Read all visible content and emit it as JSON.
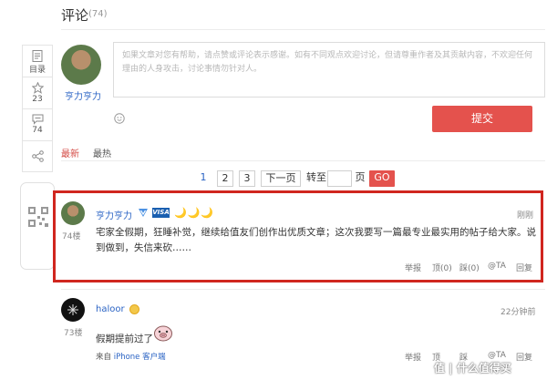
{
  "header": {
    "title": "评论",
    "count": "(74)"
  },
  "sidebar": {
    "items": [
      {
        "icon": "document-icon",
        "label": "目录"
      },
      {
        "icon": "star-icon",
        "label": "23"
      },
      {
        "icon": "comment-icon",
        "label": "74"
      },
      {
        "icon": "share-icon",
        "label": ""
      }
    ]
  },
  "composer": {
    "user_name": "亨力亨力",
    "placeholder": "如果文章对您有帮助，请点赞或评论表示感谢。如有不同观点欢迎讨论，但请尊重作者及其贡献内容，不欢迎任何理由的人身攻击，讨论事情勿针对人。",
    "submit_label": "提交"
  },
  "tabs": [
    {
      "label": "最新",
      "active": true
    },
    {
      "label": "最热",
      "active": false
    }
  ],
  "pagination": {
    "pages": [
      "1",
      "2",
      "3"
    ],
    "current": "1",
    "next_label": "下一页",
    "goto_label": "转至",
    "page_label": "页",
    "go_label": "GO"
  },
  "comments": [
    {
      "user": "亨力亨力",
      "badge": "VISA",
      "level_icons": "🌙🌙🌙",
      "floor": "74楼",
      "time": "刚刚",
      "text": "宅家全假期，狂睡补觉，继续给值友们创作出优质文章；这次我要写一篇最专业最实用的帖子给大家。说到做到，失信来砍……",
      "actions": {
        "report": "举报",
        "up": "顶(0)",
        "down": "踩(0)",
        "at": "@TA",
        "reply": "回复"
      }
    },
    {
      "user": "haloor",
      "floor": "73楼",
      "time": "22分钟前",
      "text": "假期提前过了",
      "source_prefix": "来自",
      "source_link": "iPhone 客户端",
      "actions": {
        "report": "举报",
        "up": "顶",
        "down": "踩",
        "at": "@TA",
        "reply": "回复"
      }
    }
  ],
  "watermark": "值 | 什么值得买",
  "colors": {
    "accent": "#e4524d",
    "link": "#2a63c4",
    "highlight_border": "#d0261f"
  }
}
